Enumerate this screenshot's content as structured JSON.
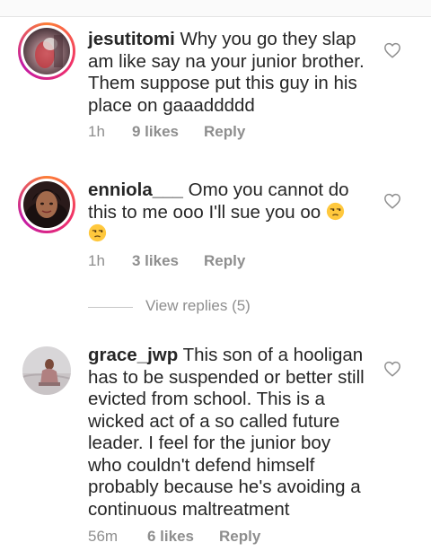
{
  "comments": [
    {
      "username": "jesutitomi",
      "text": "Why you go they slap am like say na your junior brother. Them suppose put this guy in his place on gaaaddddd",
      "time": "1h",
      "likes": "9 likes",
      "reply": "Reply",
      "has_story_ring": true,
      "liked": false
    },
    {
      "username": "enniola___",
      "text": "Omo you cannot do this to me ooo I'll sue you oo",
      "emojis": [
        "unamused-face",
        "unamused-face"
      ],
      "time": "1h",
      "likes": "3 likes",
      "reply": "Reply",
      "has_story_ring": true,
      "liked": false
    },
    {
      "username": "grace_jwp",
      "text": "This son of a hooligan has to be suspended or better still evicted from school.  This is a wicked act of a so called future leader. I feel for the junior boy who couldn't defend himself probably because he's avoiding a continuous maltreatment",
      "time": "56m",
      "likes": "6 likes",
      "reply": "Reply",
      "has_story_ring": false,
      "liked": false
    }
  ],
  "view_replies": "View replies (5)",
  "colors": {
    "text": "#262626",
    "meta": "#8e8e8e",
    "story_ring_start": "#fd7e36",
    "story_ring_end": "#c21aa5"
  }
}
